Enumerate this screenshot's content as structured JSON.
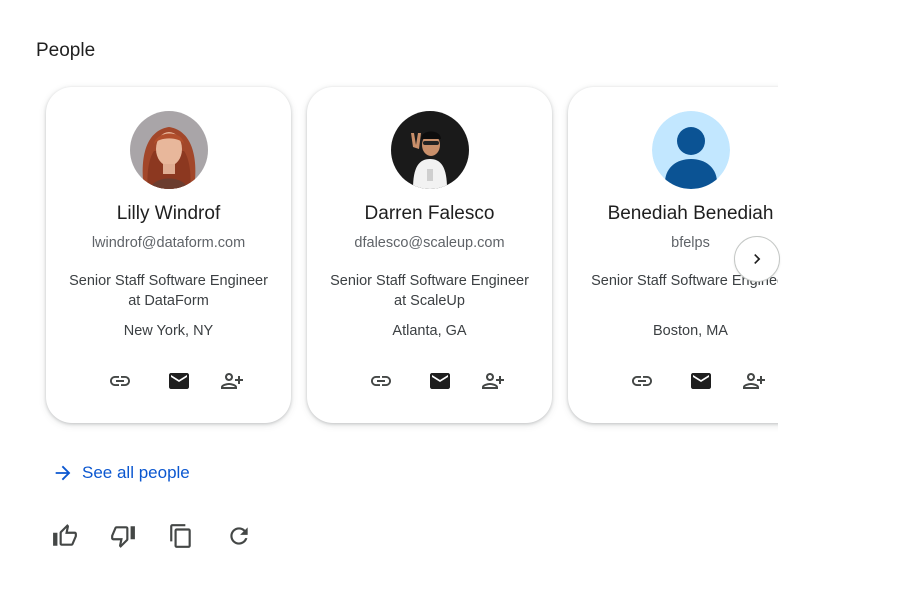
{
  "section": {
    "title": "People"
  },
  "people": [
    {
      "name": "Lilly Windrof",
      "email": "lwindrof@dataform.com",
      "title": "Senior Staff Software Engineer at DataForm",
      "location": "New York, NY",
      "avatar": "photo"
    },
    {
      "name": "Darren Falesco",
      "email": "dfalesco@scaleup.com",
      "title": "Senior Staff Software Engineer at ScaleUp",
      "location": "Atlanta, GA",
      "avatar": "photo"
    },
    {
      "name": "Benediah Benediah",
      "email": "bfelps",
      "title": "Senior Staff Software Engineer",
      "location": "Boston, MA",
      "avatar": "default-person-icon"
    }
  ],
  "card_actions": [
    "link-icon",
    "mail-icon",
    "add-person-icon"
  ],
  "carousel": {
    "next_icon": "chevron-right-icon"
  },
  "see_all": {
    "label": "See all people",
    "icon": "arrow-right-icon"
  },
  "feedback": [
    "thumbs-up-icon",
    "thumbs-down-icon",
    "copy-icon",
    "refresh-icon"
  ],
  "colors": {
    "link": "#0b57d0",
    "default_avatar_bg": "#c2e7ff",
    "default_avatar_fg": "#0b5394"
  }
}
